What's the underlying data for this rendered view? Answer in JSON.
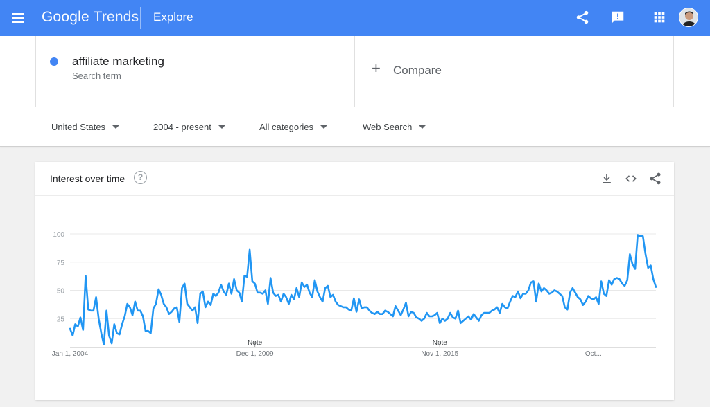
{
  "header": {
    "logo_google": "Google",
    "logo_trends": "Trends",
    "section": "Explore",
    "brand_color": "#4285f4",
    "icons": [
      "menu-icon",
      "share-icon",
      "feedback-icon",
      "apps-icon",
      "avatar"
    ]
  },
  "search": {
    "term": "affiliate marketing",
    "term_type": "Search term",
    "term_color": "#4285f4",
    "compare_label": "Compare"
  },
  "filters": {
    "region": "United States",
    "time": "2004 - present",
    "category": "All categories",
    "property": "Web Search"
  },
  "card": {
    "title": "Interest over time",
    "help": "?",
    "actions": [
      "download-icon",
      "embed-icon",
      "share-icon"
    ]
  },
  "chart_data": {
    "type": "line",
    "title": "Interest over time",
    "xlabel": "",
    "ylabel": "",
    "ylim": [
      0,
      100
    ],
    "y_ticks": [
      25,
      50,
      75,
      100
    ],
    "x_tick_labels": [
      "Jan 1, 2004",
      "Dec 1, 2009",
      "Nov 1, 2015",
      "Oct..."
    ],
    "x_tick_months": [
      0,
      71,
      142,
      201
    ],
    "notes": [
      {
        "label": "Note",
        "month": 71
      },
      {
        "label": "Note",
        "month": 142
      }
    ],
    "line_color": "#2196f3",
    "grid": true,
    "series": [
      {
        "values": [
          16,
          10,
          20,
          18,
          26,
          15,
          63,
          33,
          32,
          32,
          44,
          25,
          12,
          2,
          32,
          10,
          3,
          20,
          12,
          11,
          20,
          27,
          38,
          35,
          28,
          40,
          32,
          32,
          27,
          14,
          14,
          12,
          34,
          38,
          51,
          46,
          38,
          35,
          29,
          31,
          34,
          35,
          22,
          52,
          56,
          38,
          35,
          32,
          35,
          21,
          47,
          49,
          35,
          40,
          37,
          47,
          45,
          48,
          55,
          49,
          46,
          56,
          47,
          60,
          50,
          48,
          40,
          63,
          62,
          86,
          58,
          56,
          48,
          48,
          47,
          50,
          38,
          61,
          48,
          45,
          46,
          40,
          47,
          44,
          38,
          46,
          42,
          52,
          44,
          57,
          53,
          55,
          48,
          44,
          59,
          49,
          44,
          40,
          52,
          54,
          44,
          46,
          40,
          37,
          36,
          35,
          35,
          33,
          32,
          43,
          31,
          42,
          34,
          35,
          35,
          32,
          30,
          29,
          31,
          29,
          29,
          32,
          31,
          29,
          27,
          36,
          32,
          28,
          33,
          39,
          27,
          31,
          30,
          26,
          25,
          23,
          25,
          30,
          27,
          27,
          28,
          30,
          21,
          25,
          23,
          25,
          30,
          26,
          25,
          32,
          21,
          23,
          25,
          27,
          24,
          29,
          26,
          23,
          28,
          30,
          30,
          30,
          32,
          33,
          35,
          30,
          38,
          35,
          34,
          40,
          45,
          44,
          49,
          43,
          47,
          47,
          50,
          57,
          58,
          40,
          56,
          49,
          52,
          50,
          47,
          48,
          50,
          49,
          47,
          45,
          35,
          33,
          48,
          52,
          48,
          44,
          42,
          37,
          40,
          45,
          43,
          42,
          44,
          38,
          58,
          47,
          45,
          59,
          55,
          60,
          61,
          60,
          56,
          54,
          59,
          82,
          73,
          69,
          99,
          98,
          98,
          82,
          70,
          72,
          60,
          53
        ]
      }
    ]
  }
}
